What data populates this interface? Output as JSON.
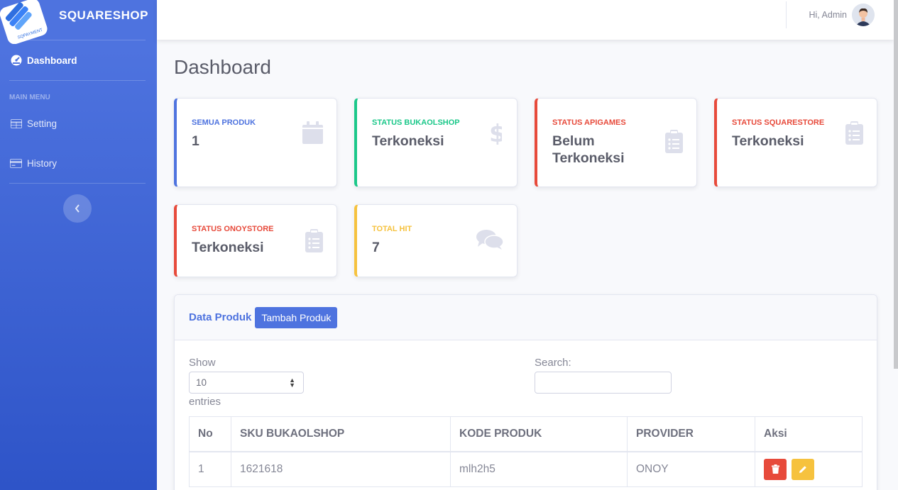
{
  "brand": {
    "name": "SQUARESHOP",
    "logo_text": "SQPAYMENT"
  },
  "sidebar": {
    "dashboard_label": "Dashboard",
    "heading": "MAIN MENU",
    "items": [
      {
        "label": "Setting",
        "icon": "table-icon"
      },
      {
        "label": "History",
        "icon": "credit-card-icon"
      }
    ]
  },
  "topbar": {
    "greeting": "Hi, Admin"
  },
  "page": {
    "title": "Dashboard"
  },
  "cards": [
    {
      "label": "SEMUA PRODUK",
      "value": "1",
      "icon": "calendar-icon",
      "color": "#4e73df"
    },
    {
      "label": "STATUS BUKAOLSHOP",
      "value": "Terkoneksi",
      "icon": "dollar-icon",
      "color": "#1cc88a"
    },
    {
      "label": "STATUS APIGAMES",
      "value": "Belum Terkoneksi",
      "icon": "clipboard-list-icon",
      "color": "#e74a3b"
    },
    {
      "label": "STATUS SQUARESTORE",
      "value": "Terkoneksi",
      "icon": "clipboard-list-icon",
      "color": "#e74a3b"
    },
    {
      "label": "STATUS ONOYSTORE",
      "value": "Terkoneksi",
      "icon": "clipboard-list-icon",
      "color": "#e74a3b"
    },
    {
      "label": "TOTAL HIT",
      "value": "7",
      "icon": "comments-icon",
      "color": "#f6c23e"
    }
  ],
  "panel": {
    "title": "Data Produk",
    "add_button": "Tambah Produk",
    "show_label": "Show",
    "entries_value": "10",
    "entries_label": "entries",
    "search_label": "Search:",
    "search_value": ""
  },
  "table": {
    "headers": [
      "No",
      "SKU BUKAOLSHOP",
      "KODE PRODUK",
      "PROVIDER",
      "Aksi"
    ],
    "rows": [
      [
        "1",
        "1621618",
        "mlh2h5",
        "ONOY"
      ]
    ]
  }
}
